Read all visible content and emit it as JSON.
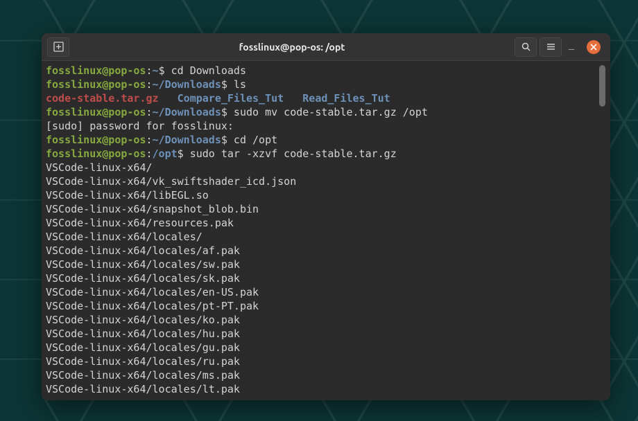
{
  "window": {
    "title": "fosslinux@pop-os: /opt"
  },
  "prompt": {
    "user_host": "fosslinux@pop-os",
    "home": "~",
    "downloads": "~/Downloads",
    "opt": "/opt"
  },
  "commands": {
    "cd_downloads": " cd Downloads",
    "ls": " ls",
    "sudo_mv": " sudo mv code-stable.tar.gz /opt",
    "cd_opt": " cd /opt",
    "sudo_tar": " sudo tar -xzvf code-stable.tar.gz"
  },
  "ls_output": {
    "file1": "code-stable.tar.gz",
    "sep1": "   ",
    "dir1": "Compare_Files_Tut",
    "sep2": "   ",
    "dir2": "Read_Files_Tut"
  },
  "sudo_prompt": "[sudo] password for fosslinux: ",
  "tar_output": {
    "l0": "VSCode-linux-x64/",
    "l1": "VSCode-linux-x64/vk_swiftshader_icd.json",
    "l2": "VSCode-linux-x64/libEGL.so",
    "l3": "VSCode-linux-x64/snapshot_blob.bin",
    "l4": "VSCode-linux-x64/resources.pak",
    "l5": "VSCode-linux-x64/locales/",
    "l6": "VSCode-linux-x64/locales/af.pak",
    "l7": "VSCode-linux-x64/locales/sw.pak",
    "l8": "VSCode-linux-x64/locales/sk.pak",
    "l9": "VSCode-linux-x64/locales/en-US.pak",
    "l10": "VSCode-linux-x64/locales/pt-PT.pak",
    "l11": "VSCode-linux-x64/locales/ko.pak",
    "l12": "VSCode-linux-x64/locales/hu.pak",
    "l13": "VSCode-linux-x64/locales/gu.pak",
    "l14": "VSCode-linux-x64/locales/ru.pak",
    "l15": "VSCode-linux-x64/locales/ms.pak",
    "l16": "VSCode-linux-x64/locales/lt.pak"
  }
}
